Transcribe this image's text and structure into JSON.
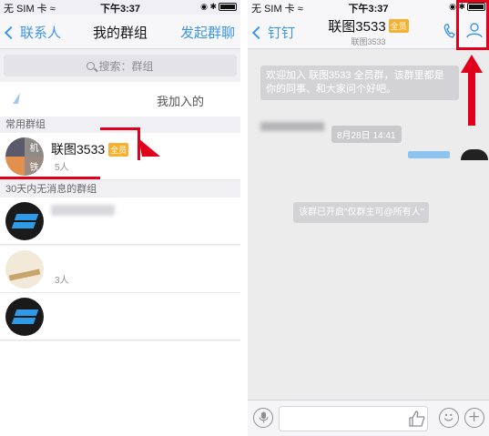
{
  "left": {
    "status": {
      "carrier": "无 SIM 卡 ≈",
      "time": "下午3:37",
      "right": "◉ ✱"
    },
    "nav": {
      "back": "联系人",
      "title": "我的群组",
      "action": "发起群聊"
    },
    "search": {
      "placeholder": "搜索：群组"
    },
    "joined_label": "我加入的",
    "section_common": "常用群组",
    "groups_common": [
      {
        "name": "联图3533",
        "badge": "全员",
        "members": "5人",
        "avatar_chars": [
          "机",
          "铁"
        ]
      }
    ],
    "section_inactive": "30天内无消息的群组",
    "groups_inactive": [
      {
        "name": "",
        "members": ""
      },
      {
        "name": "",
        "members": "3人"
      },
      {
        "name": "",
        "members": ""
      }
    ]
  },
  "right": {
    "status": {
      "carrier": "无 SIM 卡 ≈",
      "time": "下午3:37",
      "right": "◉ ✱"
    },
    "nav": {
      "back": "钉钉",
      "title": "联图3533",
      "badge": "全员",
      "subtitle": "联图3533"
    },
    "messages": {
      "welcome": "欢迎加入 联图3533 全员群，该群里都是你的同事、和大家问个好吧。",
      "time": "8月28日 14:41",
      "notice": "该群已开启\"仅群主可@所有人\""
    }
  },
  "colors": {
    "accent": "#3d96e6",
    "highlight": "#e0001b",
    "badge": "#f5b12f"
  },
  "icons": [
    "phone-icon",
    "group-members-icon",
    "mic-icon",
    "thumbs-up-icon",
    "emoji-icon",
    "plus-icon",
    "search-icon"
  ]
}
